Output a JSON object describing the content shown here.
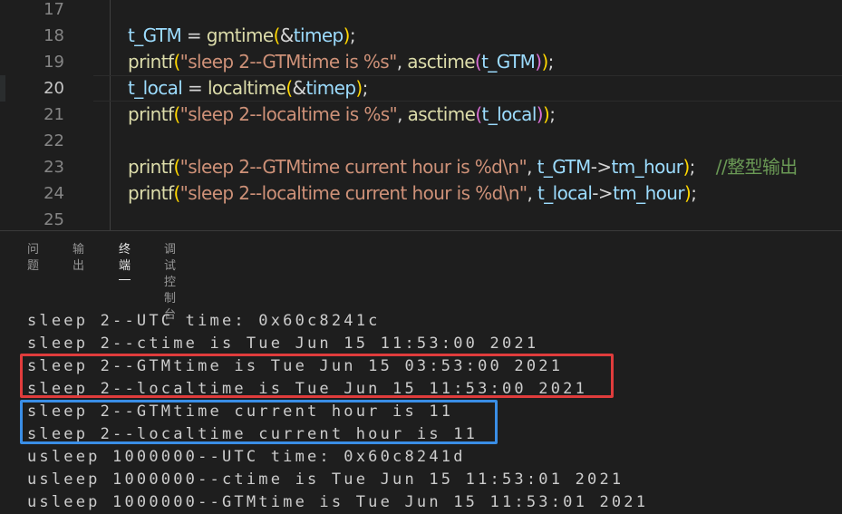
{
  "editor": {
    "lines": [
      {
        "num": "17",
        "tokens": []
      },
      {
        "num": "18",
        "tokens": [
          {
            "t": "t_GTM",
            "c": "var"
          },
          {
            "t": " = ",
            "c": "op"
          },
          {
            "t": "gmtime",
            "c": "fn"
          },
          {
            "t": "(",
            "c": "br1"
          },
          {
            "t": "&",
            "c": "op"
          },
          {
            "t": "timep",
            "c": "var"
          },
          {
            "t": ")",
            "c": "br1"
          },
          {
            "t": ";",
            "c": "op"
          }
        ]
      },
      {
        "num": "19",
        "tokens": [
          {
            "t": "printf",
            "c": "fn"
          },
          {
            "t": "(",
            "c": "br1"
          },
          {
            "t": "\"sleep 2--GTMtime is %s\"",
            "c": "str"
          },
          {
            "t": ", ",
            "c": "op"
          },
          {
            "t": "asctime",
            "c": "fn"
          },
          {
            "t": "(",
            "c": "br2"
          },
          {
            "t": "t_GTM",
            "c": "var"
          },
          {
            "t": ")",
            "c": "br2"
          },
          {
            "t": ")",
            "c": "br1"
          },
          {
            "t": ";",
            "c": "op"
          }
        ]
      },
      {
        "num": "20",
        "active": true,
        "tokens": [
          {
            "t": "t_local",
            "c": "var"
          },
          {
            "t": " = ",
            "c": "op"
          },
          {
            "t": "localtime",
            "c": "fn"
          },
          {
            "t": "(",
            "c": "br1"
          },
          {
            "t": "&",
            "c": "op"
          },
          {
            "t": "timep",
            "c": "var"
          },
          {
            "t": ")",
            "c": "br1"
          },
          {
            "t": ";",
            "c": "op"
          }
        ]
      },
      {
        "num": "21",
        "tokens": [
          {
            "t": "printf",
            "c": "fn"
          },
          {
            "t": "(",
            "c": "br1"
          },
          {
            "t": "\"sleep 2--localtime is %s\"",
            "c": "str"
          },
          {
            "t": ", ",
            "c": "op"
          },
          {
            "t": "asctime",
            "c": "fn"
          },
          {
            "t": "(",
            "c": "br2"
          },
          {
            "t": "t_local",
            "c": "var"
          },
          {
            "t": ")",
            "c": "br2"
          },
          {
            "t": ")",
            "c": "br1"
          },
          {
            "t": ";",
            "c": "op"
          }
        ]
      },
      {
        "num": "22",
        "tokens": []
      },
      {
        "num": "23",
        "tokens": [
          {
            "t": "printf",
            "c": "fn"
          },
          {
            "t": "(",
            "c": "br1"
          },
          {
            "t": "\"sleep 2--GTMtime current hour is %d\\n\"",
            "c": "str"
          },
          {
            "t": ", ",
            "c": "op"
          },
          {
            "t": "t_GTM",
            "c": "var"
          },
          {
            "t": "->",
            "c": "op"
          },
          {
            "t": "tm_hour",
            "c": "var"
          },
          {
            "t": ")",
            "c": "br1"
          },
          {
            "t": ";",
            "c": "op"
          },
          {
            "t": "    //整型输出",
            "c": "cmt"
          }
        ]
      },
      {
        "num": "24",
        "tokens": [
          {
            "t": "printf",
            "c": "fn"
          },
          {
            "t": "(",
            "c": "br1"
          },
          {
            "t": "\"sleep 2--localtime current hour is %d\\n\"",
            "c": "str"
          },
          {
            "t": ", ",
            "c": "op"
          },
          {
            "t": "t_local",
            "c": "var"
          },
          {
            "t": "->",
            "c": "op"
          },
          {
            "t": "tm_hour",
            "c": "var"
          },
          {
            "t": ")",
            "c": "br1"
          },
          {
            "t": ";",
            "c": "op"
          }
        ]
      },
      {
        "num": "25",
        "tokens": []
      }
    ]
  },
  "panel": {
    "tabs": [
      {
        "label": "问题",
        "name": "tab-problems"
      },
      {
        "label": "输出",
        "name": "tab-output"
      },
      {
        "label": "终端",
        "name": "tab-terminal",
        "active": true
      },
      {
        "label": "调试控制台",
        "name": "tab-debug-console"
      }
    ]
  },
  "terminal": {
    "lines": [
      "sleep 2--UTC time: 0x60c8241c",
      "sleep 2--ctime is Tue Jun 15 11:53:00 2021",
      "sleep 2--GTMtime is Tue Jun 15 03:53:00 2021",
      "sleep 2--localtime is Tue Jun 15 11:53:00 2021",
      "sleep 2--GTMtime current hour is 11",
      "sleep 2--localtime current hour is 11",
      "usleep 1000000--UTC time: 0x60c8241d",
      "usleep 1000000--ctime is Tue Jun 15 11:53:01 2021",
      "usleep 1000000--GTMtime is Tue Jun 15 11:53:01 2021"
    ],
    "highlights": [
      {
        "color": "#e03c3c",
        "lines": [
          2,
          3
        ]
      },
      {
        "color": "#3a8ee6",
        "lines": [
          4,
          5
        ]
      }
    ]
  },
  "colors": {
    "background": "#1e1e1e",
    "variable": "#9cdcfe",
    "function": "#dcdcaa",
    "string": "#ce9178",
    "bracket_level1": "#ffd700",
    "bracket_level2": "#da70d6",
    "comment": "#6a9955",
    "terminal_text": "#cccccc"
  }
}
